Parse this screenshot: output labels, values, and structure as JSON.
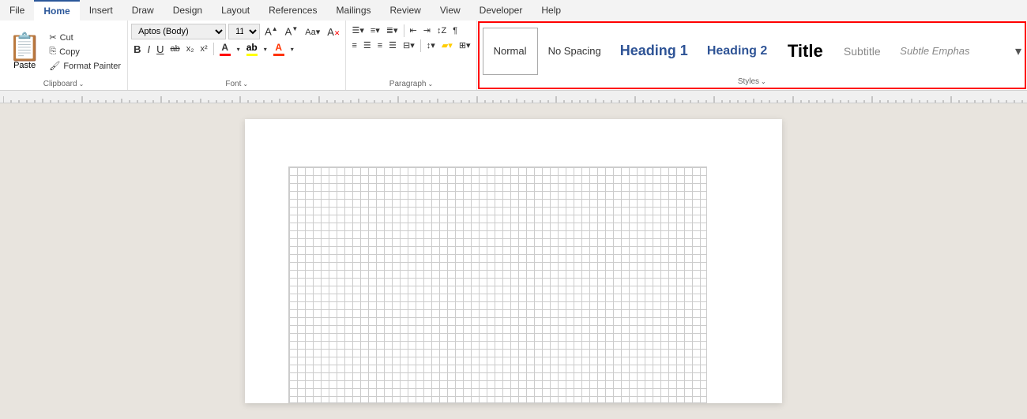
{
  "tabs": [
    {
      "label": "File",
      "active": false
    },
    {
      "label": "Home",
      "active": true
    },
    {
      "label": "Insert",
      "active": false
    },
    {
      "label": "Draw",
      "active": false
    },
    {
      "label": "Design",
      "active": false
    },
    {
      "label": "Layout",
      "active": false
    },
    {
      "label": "References",
      "active": false
    },
    {
      "label": "Mailings",
      "active": false
    },
    {
      "label": "Review",
      "active": false
    },
    {
      "label": "View",
      "active": false
    },
    {
      "label": "Developer",
      "active": false
    },
    {
      "label": "Help",
      "active": false
    }
  ],
  "clipboard": {
    "group_label": "Clipboard",
    "paste_label": "Paste",
    "cut_label": "Cut",
    "copy_label": "Copy",
    "format_painter_label": "Format Painter"
  },
  "font": {
    "group_label": "Font",
    "font_name": "Aptos (Body)",
    "font_size": "11",
    "bold": "B",
    "italic": "I",
    "underline": "U",
    "strikethrough": "ab",
    "subscript": "x₂",
    "superscript": "x²"
  },
  "paragraph": {
    "group_label": "Paragraph"
  },
  "styles": {
    "group_label": "Styles",
    "items": [
      {
        "label": "Normal",
        "style": "normal"
      },
      {
        "label": "No Spacing",
        "style": "no-spacing"
      },
      {
        "label": "Heading 1",
        "style": "heading1"
      },
      {
        "label": "Heading 2",
        "style": "heading2"
      },
      {
        "label": "Title",
        "style": "title"
      },
      {
        "label": "Subtitle",
        "style": "subtitle"
      },
      {
        "label": "Subtle Emphas",
        "style": "subtle"
      }
    ]
  }
}
